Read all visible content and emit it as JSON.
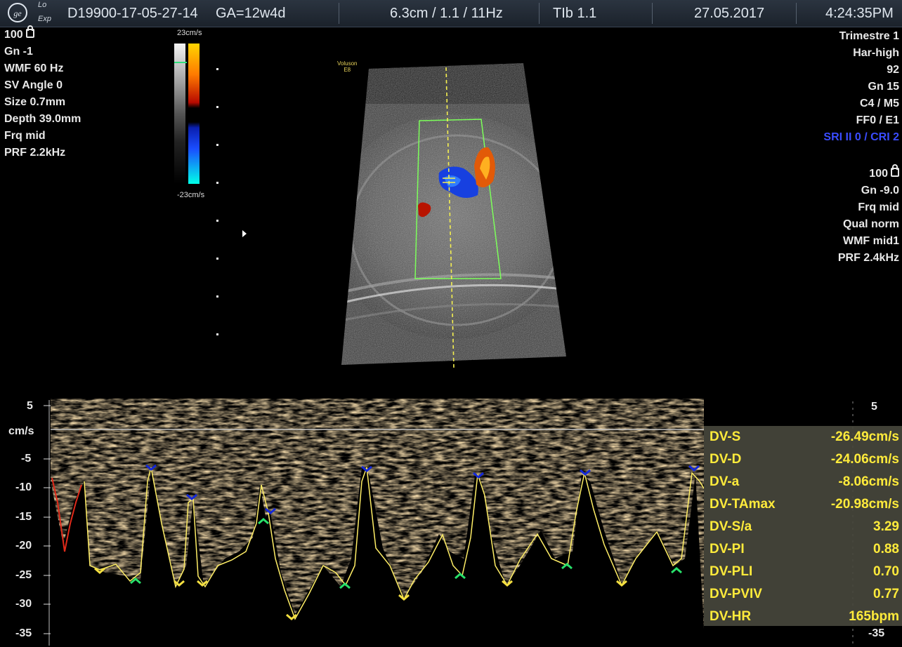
{
  "header": {
    "patient_id": "D19900-17-05-27-14",
    "gestational_age": "GA=12w4d",
    "probe_settings": "6.3cm / 1.1 / 11Hz",
    "thermal_index": "TIb 1.1",
    "date": "27.05.2017",
    "time": "4:24:35PM",
    "mode_top": "Lo",
    "mode_bottom": "Exp"
  },
  "left_params": [
    "100",
    "Gn -1",
    "WMF 60 Hz",
    "SV Angle  0",
    "Size  0.7mm",
    "Depth 39.0mm",
    "Frq mid",
    "PRF  2.2kHz"
  ],
  "right_params_top": [
    "Trimestre 1",
    "Har-high",
    "92",
    "Gn  15",
    "C4 / M5",
    "FF0 / E1",
    "SRI II 0 / CRI 2"
  ],
  "right_params_bottom": [
    "100",
    "Gn -9.0",
    "Frq mid",
    "Qual norm",
    "WMF mid1",
    "PRF  2.4kHz"
  ],
  "colorbar": {
    "max_label": "23cm/s",
    "min_label": "-23cm/s"
  },
  "image_label": {
    "line1": "Voluson",
    "line2": "E8"
  },
  "doppler_scale": {
    "left": [
      "5",
      "cm/s",
      "-5",
      "-10",
      "-15",
      "-20",
      "-25",
      "-30",
      "-35"
    ],
    "right_top": "5",
    "right_bottom": "-35"
  },
  "measurements": [
    {
      "label": "DV-S",
      "value": "-26.49cm/s"
    },
    {
      "label": "DV-D",
      "value": "-24.06cm/s"
    },
    {
      "label": "DV-a",
      "value": "-8.06cm/s"
    },
    {
      "label": "DV-TAmax",
      "value": "-20.98cm/s"
    },
    {
      "label": "DV-S/a",
      "value": "3.29"
    },
    {
      "label": "DV-PI",
      "value": "0.88"
    },
    {
      "label": "DV-PLI",
      "value": "0.70"
    },
    {
      "label": "DV-PVIV",
      "value": "0.77"
    },
    {
      "label": "DV-HR",
      "value": "165bpm"
    }
  ],
  "colors": {
    "header_bg": "#1f2730",
    "measure_text": "#ffeb3b",
    "trace": "#ffee66",
    "sample_box": "#7cff5a",
    "blue_text": "#3a4cff"
  }
}
